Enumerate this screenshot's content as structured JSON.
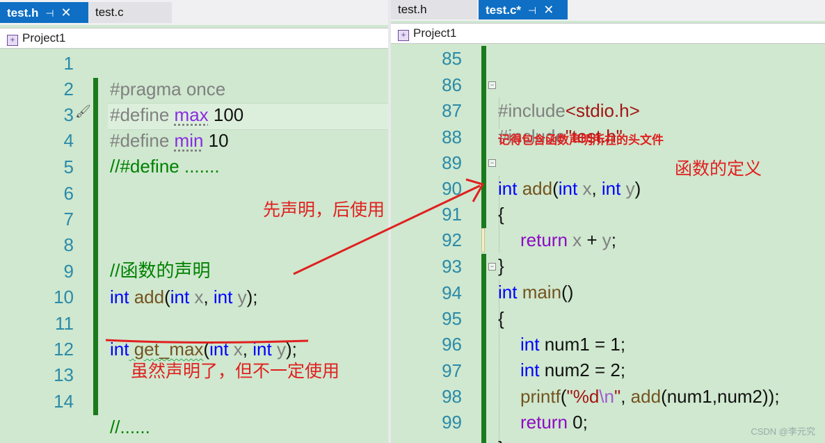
{
  "left": {
    "tabs": [
      {
        "label": "test.h",
        "active": true,
        "pin": "⊣",
        "close": "✕"
      },
      {
        "label": "test.c",
        "active": false
      }
    ],
    "project": "Project1",
    "lines": [
      {
        "n": "1"
      },
      {
        "n": "2"
      },
      {
        "n": "3"
      },
      {
        "n": "4"
      },
      {
        "n": "5"
      },
      {
        "n": "6"
      },
      {
        "n": "7"
      },
      {
        "n": "8"
      },
      {
        "n": "9"
      },
      {
        "n": "10"
      },
      {
        "n": "11"
      },
      {
        "n": "12"
      },
      {
        "n": "13"
      },
      {
        "n": "14"
      }
    ],
    "code": {
      "l1": {
        "a": "#pragma once"
      },
      "l2": {
        "a": "#define ",
        "b": "max",
        "c": " 100"
      },
      "l3": {
        "a": "#define ",
        "b": "min",
        "c": " 10"
      },
      "l4": {
        "a": "//#define ......."
      },
      "l8": {
        "a": "//函数的声明"
      },
      "l9": {
        "kw1": "int",
        "fn": " add",
        "p1": "(",
        "kw2": "int",
        "x": " x",
        ",": ", ",
        "kw3": "int",
        "y": " y",
        ")": ");"
      },
      "l11": {
        "kw1": "int",
        "fn": " get_max",
        "p1": "(",
        "kw2": "int",
        "x": " x",
        ",": ", ",
        "kw3": "int",
        "y": " y",
        ")": ");"
      },
      "l14": {
        "a": "//......"
      }
    }
  },
  "right": {
    "tabs": [
      {
        "label": "test.h",
        "active": false
      },
      {
        "label": "test.c*",
        "active": true,
        "pin": "⊣",
        "close": "✕"
      }
    ],
    "project": "Project1",
    "lines": [
      {
        "n": "85"
      },
      {
        "n": "86"
      },
      {
        "n": "87"
      },
      {
        "n": "88"
      },
      {
        "n": "89"
      },
      {
        "n": "90"
      },
      {
        "n": "91"
      },
      {
        "n": "92"
      },
      {
        "n": "93"
      },
      {
        "n": "94"
      },
      {
        "n": "95"
      },
      {
        "n": "96"
      },
      {
        "n": "97"
      },
      {
        "n": "98"
      },
      {
        "n": "99"
      }
    ],
    "code": {
      "l86": {
        "a": "#include",
        "b": "<stdio.h>"
      },
      "l87": {
        "a": "#include",
        "b": "\"test.h\""
      },
      "l89": {
        "kw1": "int",
        "fn": " add",
        "p1": "(",
        "kw2": "int",
        "x": " x",
        ",": ", ",
        "kw3": "int",
        "y": " y",
        ")": ")"
      },
      "l90": {
        "a": "{"
      },
      "l91": {
        "ret": "return",
        "x": " x",
        "op": " + ",
        "y": "y",
        ";": ";"
      },
      "l92": {
        "a": "}"
      },
      "l93": {
        "kw": "int",
        "fn": " main",
        "p": "()"
      },
      "l94": {
        "a": "{"
      },
      "l95": {
        "kw": "int",
        "v": " num1 = 1;"
      },
      "l96": {
        "kw": "int",
        "v": " num2 = 2;"
      },
      "l97": {
        "fn": "printf",
        "p1": "(",
        "s1": "\"%d",
        "esc": "\\n",
        "s2": "\"",
        ",": ", ",
        "fn2": "add",
        "rest": "(num1,num2));"
      },
      "l98": {
        "ret": "return",
        "v": " 0;"
      },
      "l99": {
        "a": "}"
      }
    }
  },
  "annotations": {
    "declare_first": "先声明，后使用",
    "declared_not_used": "虽然声明了，但不一定使用",
    "include_note": "记得包含函数声明所在的头文件",
    "definition": "函数的定义"
  },
  "watermark": "CSDN @李元究",
  "colors": {
    "accent_tab": "#0e6fc4",
    "annotation_red": "#e02020",
    "editor_bg": "#cfe8cf",
    "change_bar": "#1b7a1b"
  }
}
